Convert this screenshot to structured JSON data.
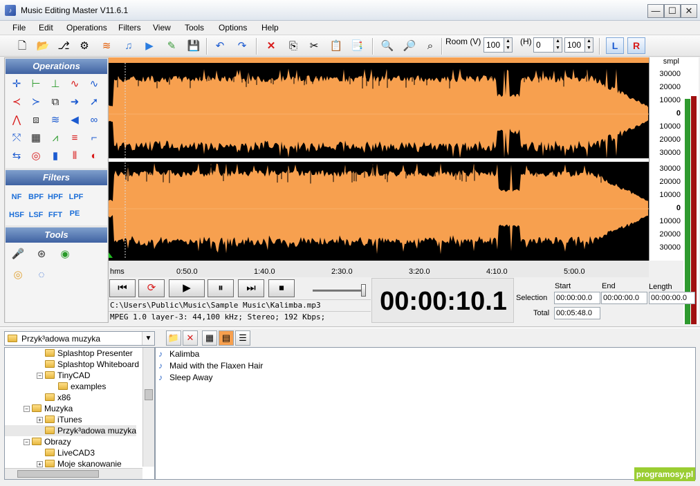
{
  "window": {
    "title": "Music Editing Master V11.6.1",
    "min_label": "—",
    "max_label": "☐",
    "close_label": "✕"
  },
  "menu": [
    "File",
    "Edit",
    "Operations",
    "Filters",
    "View",
    "Tools",
    "Options",
    "Help"
  ],
  "toolbar": {
    "room_v_label": "Room (V)",
    "room_v_value": "100",
    "h_label": "(H)",
    "h_value1": "0",
    "h_value2": "100",
    "left_channel": "L",
    "right_channel": "R"
  },
  "panels": {
    "operations_title": "Operations",
    "filters_title": "Filters",
    "tools_title": "Tools",
    "filters": [
      "NF",
      "BPF",
      "HPF",
      "LPF",
      "HSF",
      "LSF",
      "FFT",
      "PE"
    ]
  },
  "scale": {
    "unit": "smpl",
    "top_channel": [
      "30000",
      "20000",
      "10000",
      "0",
      "10000",
      "20000",
      "30000"
    ],
    "bottom_channel": [
      "30000",
      "20000",
      "10000",
      "0",
      "10000",
      "20000",
      "30000"
    ]
  },
  "timeline": {
    "unit": "hms",
    "ticks": [
      "0:50.0",
      "1:40.0",
      "2:30.0",
      "3:20.0",
      "4:10.0",
      "5:00.0"
    ]
  },
  "status": {
    "file_path": "C:\\Users\\Public\\Music\\Sample Music\\Kalimba.mp3",
    "format": "MPEG 1.0 layer-3: 44,100 kHz; Stereo; 192 Kbps;"
  },
  "clock": "00:00:10.1",
  "selection": {
    "start_label": "Start",
    "end_label": "End",
    "length_label": "Length",
    "selection_label": "Selection",
    "total_label": "Total",
    "start": "00:00:00.0",
    "end": "00:00:00.0",
    "length": "00:00:00.0",
    "total": "00:05:48.0"
  },
  "browser": {
    "current_folder": "Przyk³adowa muzyka",
    "tree": [
      {
        "label": "Splashtop Presenter",
        "indent": 2,
        "pm": ""
      },
      {
        "label": "Splashtop Whiteboard",
        "indent": 2,
        "pm": ""
      },
      {
        "label": "TinyCAD",
        "indent": 2,
        "pm": "−"
      },
      {
        "label": "examples",
        "indent": 3,
        "pm": ""
      },
      {
        "label": "x86",
        "indent": 2,
        "pm": ""
      },
      {
        "label": "Muzyka",
        "indent": 1,
        "pm": "−"
      },
      {
        "label": "iTunes",
        "indent": 2,
        "pm": "+"
      },
      {
        "label": "Przyk³adowa muzyka",
        "indent": 2,
        "pm": ""
      },
      {
        "label": "Obrazy",
        "indent": 1,
        "pm": "−"
      },
      {
        "label": "LiveCAD3",
        "indent": 2,
        "pm": ""
      },
      {
        "label": "Moje skanowanie",
        "indent": 2,
        "pm": "+"
      }
    ],
    "files": [
      "Kalimba",
      "Maid with the Flaxen Hair",
      "Sleep Away"
    ]
  },
  "watermark": "programosy.pl",
  "colors": {
    "wave": "#f7a04f",
    "wave_bg": "#000000",
    "header": "#3f62a2"
  }
}
